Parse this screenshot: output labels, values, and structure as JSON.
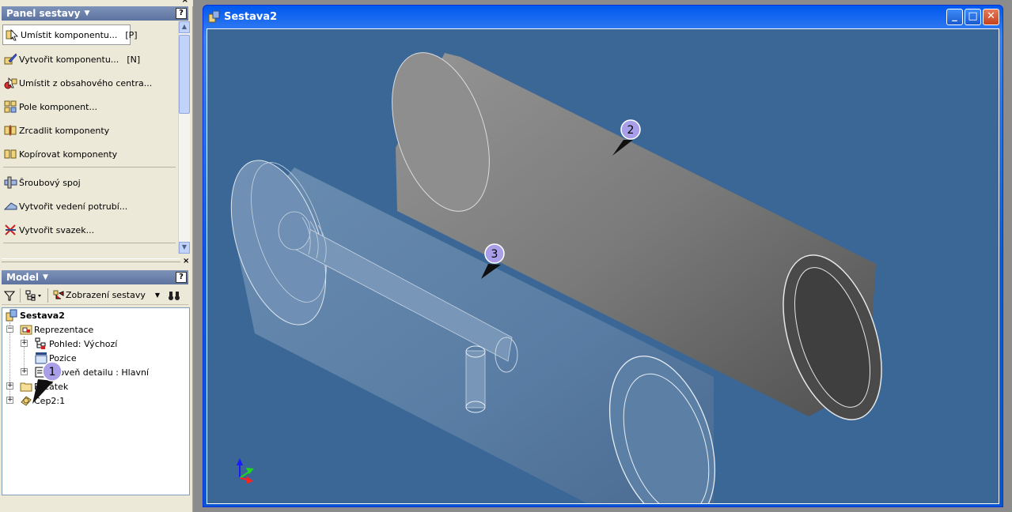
{
  "assembly_panel": {
    "title": "Panel sestavy",
    "commands": [
      {
        "label": "Umístit komponentu...",
        "key": "[P]"
      },
      {
        "label": "Vytvořit komponentu...",
        "key": "[N]"
      },
      {
        "label": "Umístit z obsahového centra...",
        "key": ""
      },
      {
        "label": "Pole komponent...",
        "key": ""
      },
      {
        "label": "Zrcadlit komponenty",
        "key": ""
      },
      {
        "label": "Kopírovat komponenty",
        "key": ""
      },
      {
        "label": "Šroubový spoj",
        "key": ""
      },
      {
        "label": "Vytvořit vedení potrubí...",
        "key": ""
      },
      {
        "label": "Vytvořit svazek...",
        "key": ""
      }
    ]
  },
  "model_panel": {
    "title": "Model",
    "view_label": "Zobrazení sestavy",
    "tree": [
      {
        "label": "Sestava2"
      },
      {
        "label": "Reprezentace"
      },
      {
        "label": "Pohled: Výchozí"
      },
      {
        "label": "Pozice"
      },
      {
        "label": "Úroveň detailu : Hlavní"
      },
      {
        "label": "Počátek"
      },
      {
        "label": "Čep2:1"
      }
    ]
  },
  "document_window": {
    "title": "Sestava2"
  },
  "callouts": [
    "1",
    "2",
    "3"
  ],
  "colors": {
    "viewport_bg": "#3a6796",
    "panel_header": "#6a80ab",
    "callout": "#a99ee8"
  }
}
